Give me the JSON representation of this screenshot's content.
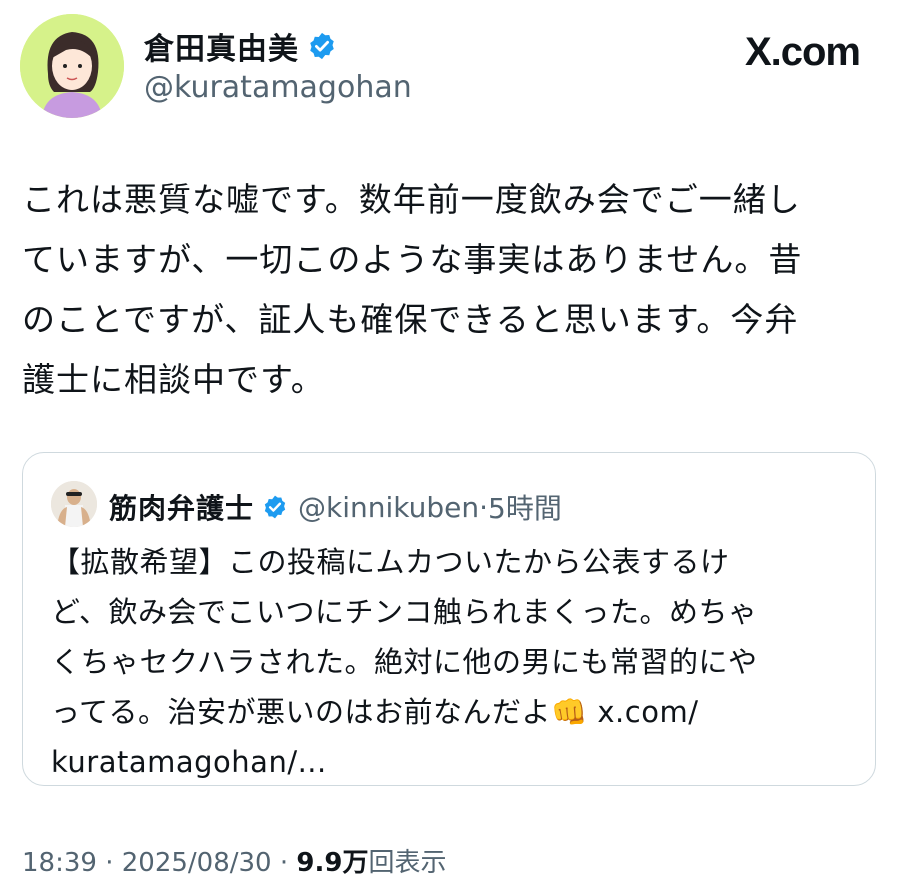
{
  "author": {
    "name": "倉田真由美",
    "handle": "@kuratamagohan",
    "verified": true,
    "avatar_icon": "cartoon-woman-avatar-icon"
  },
  "site_logo": "X.com",
  "tweet": {
    "text": "これは悪質な嘘です。数年前一度飲み会でご一緒し\nていますが、一切このような事実はありません。昔\nのことですが、証人も確保できると思います。今弁\n護士に相談中です。"
  },
  "quoted": {
    "name": "筋肉弁護士",
    "verified": true,
    "handle": "@kinnikuben",
    "separator": "·",
    "time": "5時間",
    "avatar_icon": "muscle-man-avatar-icon",
    "text": "【拡散希望】この投稿にムカついたから公表するけ\nど、飲み会でこいつにチンコ触られまくった。めちゃ\nくちゃセクハラされた。絶対に他の男にも常習的にや\nってる。治安が悪いのはお前なんだよ👊 x.com/\nkuratamagohan/..."
  },
  "footer": {
    "time": "18:39",
    "dot1": "·",
    "date": "2025/08/30",
    "dot2": "·",
    "views": "9.9万",
    "views_label": "回表示"
  },
  "colors": {
    "verified_blue": "#1d9bf0",
    "text": "#0f1419",
    "secondary": "#536471",
    "border": "#cfd9de"
  }
}
